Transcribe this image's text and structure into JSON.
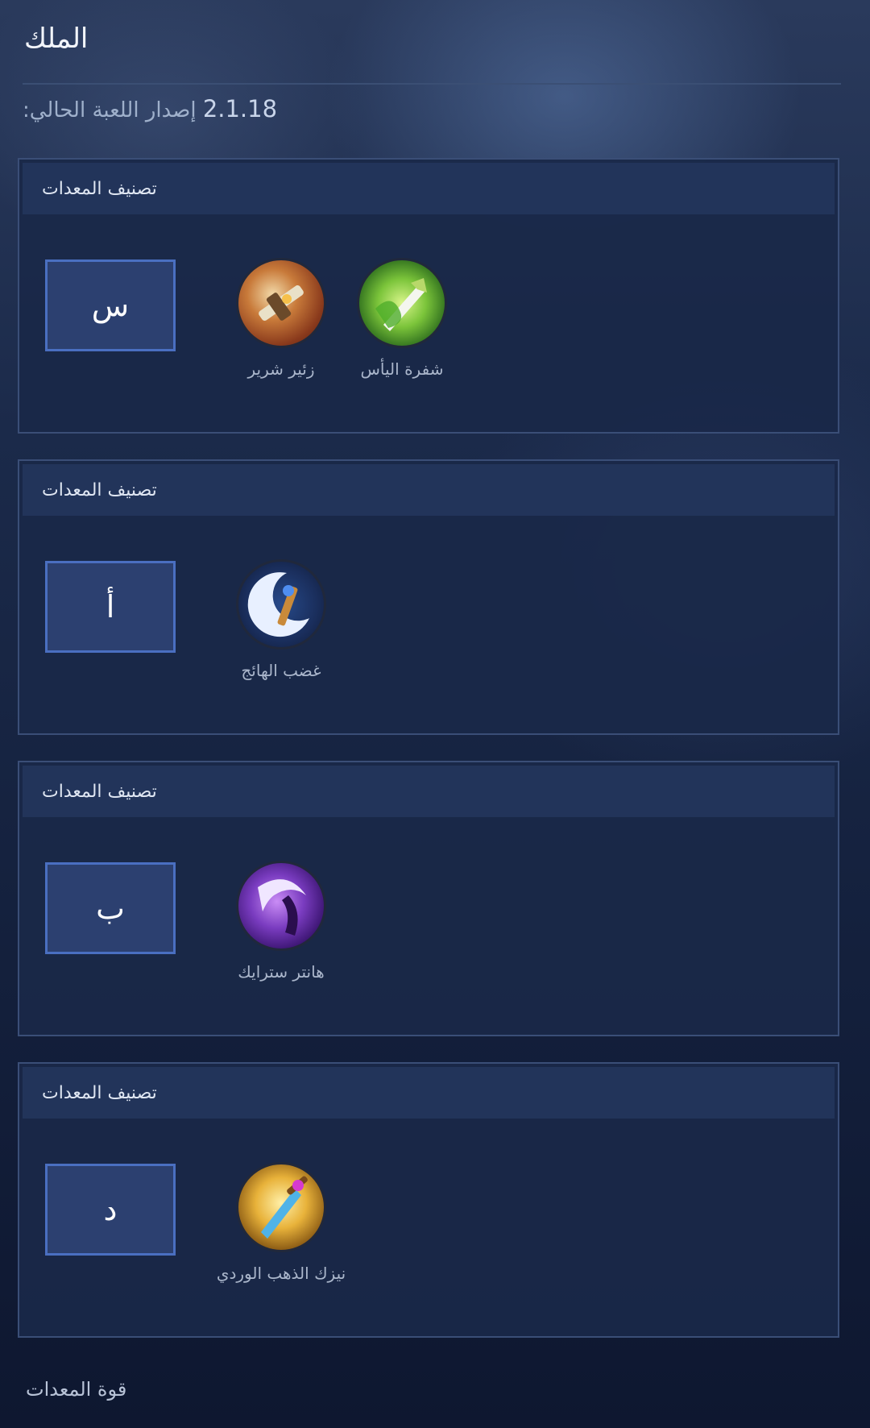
{
  "page": {
    "title": "الملك",
    "version_label": "إصدار اللعبة الحالي:",
    "version_number": "2.1.18",
    "footer_label": "قوة المعدات"
  },
  "cards": [
    {
      "header": "تصنيف المعدات",
      "tier": "س",
      "items": [
        {
          "name": "زئير شرير",
          "icon": "orange-gun-icon"
        },
        {
          "name": "شفرة اليأس",
          "icon": "green-blade-icon"
        }
      ]
    },
    {
      "header": "تصنيف المعدات",
      "tier": "أ",
      "items": [
        {
          "name": "غضب الهائج",
          "icon": "blue-crescent-axe-icon"
        }
      ]
    },
    {
      "header": "تصنيف المعدات",
      "tier": "ب",
      "items": [
        {
          "name": "هانتر سترايك",
          "icon": "purple-scythe-icon"
        }
      ]
    },
    {
      "header": "تصنيف المعدات",
      "tier": "د",
      "items": [
        {
          "name": "نيزك الذهب الوردي",
          "icon": "golden-sword-icon"
        }
      ]
    }
  ],
  "colors": {
    "tier_box_border": "#4a6fc1",
    "tier_box_fill": "#2c4070",
    "card_header": "#22345a",
    "card_body": "#1a2848"
  }
}
